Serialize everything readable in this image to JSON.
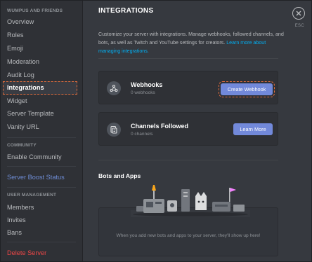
{
  "sidebar": {
    "server_header": "WUMPUS AND FRIENDS",
    "items": [
      {
        "label": "Overview"
      },
      {
        "label": "Roles"
      },
      {
        "label": "Emoji"
      },
      {
        "label": "Moderation"
      },
      {
        "label": "Audit Log"
      },
      {
        "label": "Integrations",
        "selected": true
      },
      {
        "label": "Widget"
      },
      {
        "label": "Server Template"
      },
      {
        "label": "Vanity URL"
      }
    ],
    "community_header": "COMMUNITY",
    "enable_community": "Enable Community",
    "server_boost": "Server Boost Status",
    "user_management_header": "USER MANAGEMENT",
    "user_items": [
      {
        "label": "Members"
      },
      {
        "label": "Invites"
      },
      {
        "label": "Bans"
      }
    ],
    "delete_server": "Delete Server"
  },
  "main": {
    "title": "INTEGRATIONS",
    "description": "Customize your server with integrations. Manage webhooks, followed channels, and bots, as well as Twitch and YouTube settings for creators.",
    "learn_more_link": "Learn more about managing integrations.",
    "webhooks": {
      "title": "Webhooks",
      "subtitle": "0 webhooks",
      "button": "Create Webhook",
      "icon": "webhook-icon"
    },
    "channels": {
      "title": "Channels Followed",
      "subtitle": "0 channels",
      "button": "Learn More",
      "icon": "channel-follow-icon"
    },
    "bots_title": "Bots and Apps",
    "bots_empty": "When you add new bots and apps to your server, they'll show up here!"
  },
  "close": {
    "label": "ESC",
    "icon": "close-icon"
  },
  "colors": {
    "accent": "#7289da",
    "danger": "#f04747",
    "link": "#00b0f4",
    "highlight": "#e06c3c"
  }
}
